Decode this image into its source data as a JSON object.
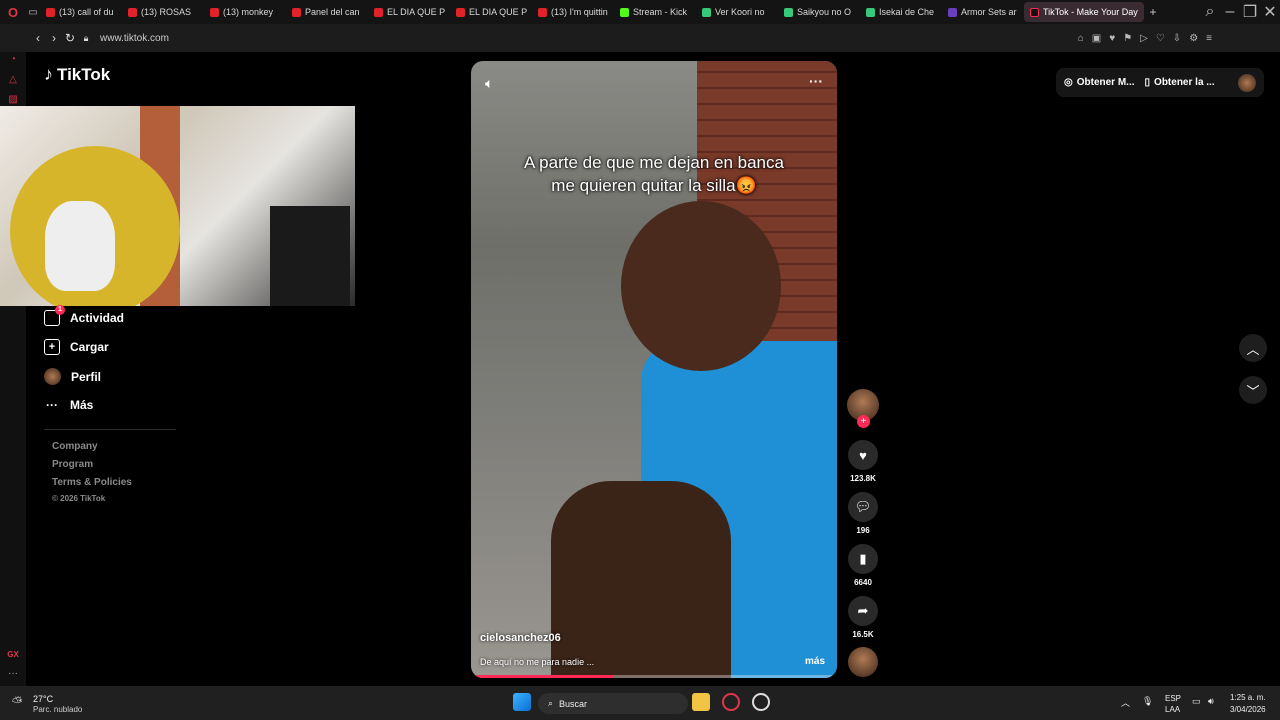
{
  "browser": {
    "tabs": [
      {
        "label": "(13) call of du",
        "color": "#e0222b"
      },
      {
        "label": "(13) ROSAS",
        "color": "#e0222b"
      },
      {
        "label": "(13) monkey",
        "color": "#e0222b"
      },
      {
        "label": "Panel del can",
        "color": "#e0222b"
      },
      {
        "label": "EL DIA QUE P",
        "color": "#e0222b"
      },
      {
        "label": "EL DIA QUE P",
        "color": "#e0222b"
      },
      {
        "label": "(13) I'm quittin",
        "color": "#e0222b"
      },
      {
        "label": "Stream - Kick",
        "color": "#53fc18"
      },
      {
        "label": "Ver Koori no",
        "color": "#37c97b"
      },
      {
        "label": "Saikyou no O",
        "color": "#37c97b"
      },
      {
        "label": "Isekai de Che",
        "color": "#37c97b"
      },
      {
        "label": "Armor Sets ar",
        "color": "#6a3fbf"
      }
    ],
    "active_tab": "TikTok - Make Your Day",
    "url": "www.tiktok.com"
  },
  "sidebar": {
    "logo": "TikTok",
    "menu": [
      {
        "label": "Actividad",
        "badge": "1",
        "icon": "inbox-icon"
      },
      {
        "label": "Cargar",
        "icon": "upload-icon"
      },
      {
        "label": "Perfil",
        "icon": "profile-avatar-icon"
      },
      {
        "label": "Más",
        "icon": "more-dots-icon"
      }
    ],
    "footer": [
      "Company",
      "Program",
      "Terms & Policies",
      "© 2026 TikTok"
    ]
  },
  "video": {
    "caption": "A parte de que me dejan en banca me quieren quitar la silla😡",
    "author": "cielosanchez06",
    "description": "De aquí no me para nadie ...",
    "more": "más",
    "progress": 0.39
  },
  "actions": {
    "likes": "123.8K",
    "comments": "196",
    "saves": "6640",
    "shares": "16.5K"
  },
  "topright": {
    "coins": "Obtener M...",
    "app": "Obtener la ..."
  },
  "taskbar": {
    "weather_temp": "27°C",
    "weather_desc": "Parc. nublado",
    "search": "Buscar",
    "lang1": "ESP",
    "lang2": "LAA",
    "time": "1:25 a. m.",
    "date": "3/04/2026"
  },
  "colors": {
    "accent": "#fe2c55",
    "tab_active": "#3a2a32"
  }
}
